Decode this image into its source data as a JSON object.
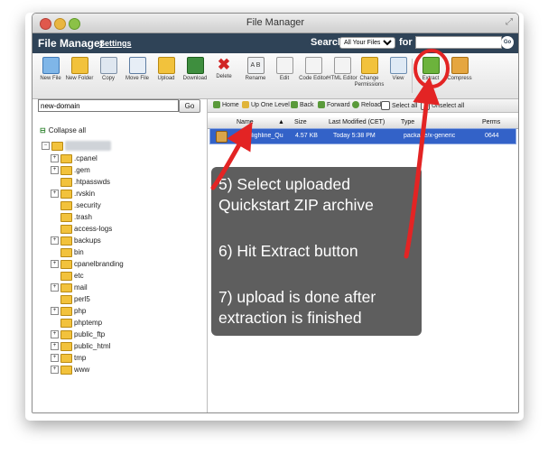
{
  "window": {
    "title": "File Manager"
  },
  "header": {
    "app_title": "File Manager",
    "settings_label": "Settings",
    "search_label": "Search",
    "search_scope": "All Your Files",
    "for_label": "for",
    "search_value": "",
    "go_label": "Go"
  },
  "toolbar": {
    "new_file": "New File",
    "new_folder": "New Folder",
    "copy": "Copy",
    "move_file": "Move File",
    "upload": "Upload",
    "download": "Download",
    "delete": "Delete",
    "rename": "Rename",
    "edit": "Edit",
    "code_editor": "Code Editor",
    "html_editor": "HTML Editor",
    "change_permissions": "Change Permissions",
    "view": "View",
    "extract": "Extract",
    "compress": "Compress"
  },
  "left": {
    "path_value": "new-domain",
    "path_go": "Go",
    "collapse_all": "Collapse all",
    "tree": [
      ".cpanel",
      ".gem",
      ".htpasswds",
      ".rvskin",
      ".security",
      ".trash",
      "access-logs",
      "backups",
      "bin",
      "cpanelbranding",
      "etc",
      "mail",
      "perl5",
      "php",
      "phptemp",
      "public_ftp",
      "public_html",
      "tmp",
      "www"
    ]
  },
  "nav": {
    "home": "Home",
    "up_one_level": "Up One Level",
    "back": "Back",
    "forward": "Forward",
    "reload": "Reload",
    "select_all": "Select all",
    "unselect_all": "Unselect all"
  },
  "columns": {
    "name": "Name",
    "size": "Size",
    "modified": "Last Modified (CET)",
    "type": "Type",
    "perms": "Perms"
  },
  "files": [
    {
      "name": "JB_Highline_Qu",
      "size": "4.57 KB",
      "modified": "Today 5:38 PM",
      "type": "package/x-generic",
      "perms": "0644"
    }
  ],
  "annotation": {
    "line1": "5) Select uploaded",
    "line2": "Quickstart ZIP archive",
    "line3": "6) Hit Extract button",
    "line4": "7) upload is done after",
    "line5": "extraction is finished"
  },
  "colors": {
    "header_bg": "#2f4357",
    "selected_row": "#3362c8",
    "annotation_bg": "#585858",
    "arrow": "#e32424"
  }
}
